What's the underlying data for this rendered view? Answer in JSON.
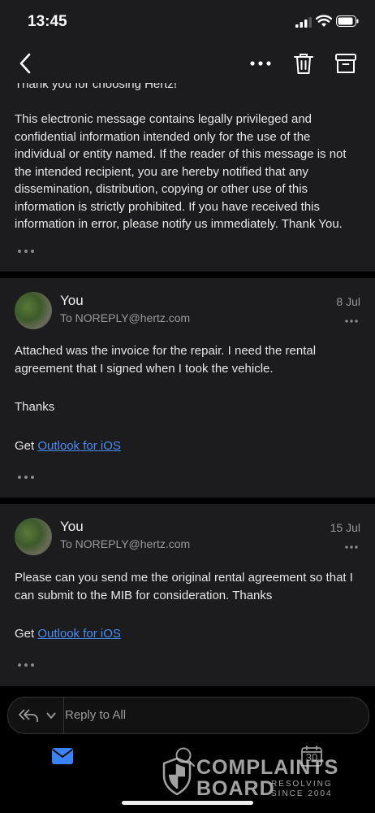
{
  "status_bar": {
    "time": "13:45"
  },
  "nav_bar": {
    "back_icon": "chevron-left-icon",
    "more_icon": "ellipsis-icon",
    "delete_icon": "trash-icon",
    "archive_icon": "archive-icon"
  },
  "messages": [
    {
      "cut_line": "Thank you for choosing Hertz!",
      "body": "This electronic message contains legally privileged and confidential information intended only for the use of the individual or entity named. If the reader of this message is not the intended recipient, you are hereby notified that any dissemination, distribution, copying or other use of this information is strictly prohibited. If you have received this information in error, please notify us immediately. Thank You."
    },
    {
      "sender": "You",
      "to": "To NOREPLY@hertz.com",
      "date": "8 Jul",
      "body": "Attached was the invoice for the repair. I need the rental agreement that I signed when I took the vehicle.",
      "closing": "Thanks",
      "signature_prefix": "Get",
      "signature_link": "Outlook for iOS"
    },
    {
      "sender": "You",
      "to": "To NOREPLY@hertz.com",
      "date": "15 Jul",
      "body": "Please can you send me the original rental agreement so that I can submit to the MIB for consideration. Thanks",
      "signature_prefix": "Get",
      "signature_link": "Outlook for iOS"
    }
  ],
  "reply_bar": {
    "label": "Reply to All"
  },
  "tab_bar": {
    "calendar_day": "30"
  },
  "watermark": {
    "line1": "COMPLAINTS",
    "line2": "BOARD",
    "tagline_1": "RESOLVING",
    "tagline_2": "SINCE 2004"
  },
  "colors": {
    "background": "#000000",
    "card": "#1c1c1e",
    "link": "#4a8cf0",
    "accent": "#3b82f6"
  }
}
